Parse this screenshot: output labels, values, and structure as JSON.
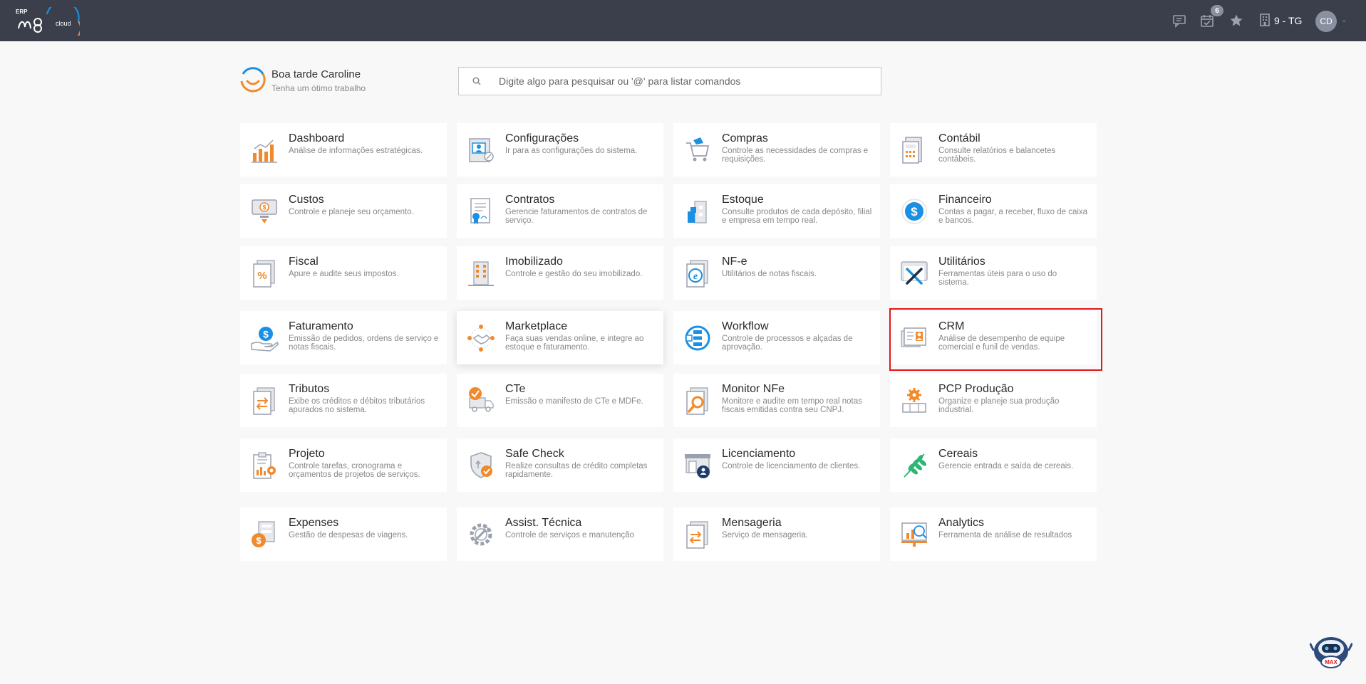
{
  "topbar": {
    "logo_erp": "ERP",
    "logo_cloud": "cloud",
    "badge_count": "6",
    "company": "9 - TG",
    "avatar": "CD",
    "icons": [
      "chat-icon",
      "calendar-check-icon",
      "star-icon",
      "building-icon",
      "chevron-down-icon"
    ]
  },
  "greeting": {
    "title": "Boa tarde Caroline",
    "subtitle": "Tenha um ótimo trabalho"
  },
  "search": {
    "placeholder": "Digite algo para pesquisar ou '@' para listar comandos"
  },
  "modules": [
    {
      "title": "Dashboard",
      "desc": "Análise de informações estratégicas.",
      "icon": "bar-chart-icon"
    },
    {
      "title": "Configurações",
      "desc": "Ir para as configurações do sistema.",
      "icon": "settings-profile-icon"
    },
    {
      "title": "Compras",
      "desc": "Controle as necessidades de compras e requisições.",
      "icon": "shopping-cart-icon"
    },
    {
      "title": "Contábil",
      "desc": "Consulte relatórios e balancetes contábeis.",
      "icon": "calculator-icon"
    },
    {
      "title": "Custos",
      "desc": "Controle e planeje seu orçamento.",
      "icon": "cost-monitor-icon"
    },
    {
      "title": "Contratos",
      "desc": "Gerencie faturamentos de contratos de serviço.",
      "icon": "contract-icon"
    },
    {
      "title": "Estoque",
      "desc": "Consulte produtos de cada depósito, filial e empresa em tempo real.",
      "icon": "warehouse-icon"
    },
    {
      "title": "Financeiro",
      "desc": "Contas a pagar, a receber, fluxo de caixa e bancos.",
      "icon": "dollar-circle-icon"
    },
    {
      "title": "Fiscal",
      "desc": "Apure e audite seus impostos.",
      "icon": "percent-document-icon"
    },
    {
      "title": "Imobilizado",
      "desc": "Controle e gestão do seu imobilizado.",
      "icon": "building-asset-icon"
    },
    {
      "title": "NF-e",
      "desc": "Utilitários de notas fiscais.",
      "icon": "nfe-document-icon"
    },
    {
      "title": "Utilitários",
      "desc": "Ferramentas úteis para o uso do sistema.",
      "icon": "tools-icon"
    },
    {
      "title": "Faturamento",
      "desc": "Emissão de pedidos, ordens de serviço e notas fiscais.",
      "icon": "billing-hand-icon"
    },
    {
      "title": "Marketplace",
      "desc": "Faça suas vendas online, e integre ao estoque e faturamento.",
      "icon": "handshake-network-icon"
    },
    {
      "title": "Workflow",
      "desc": "Controle de processos e alçadas de aprovação.",
      "icon": "workflow-icon"
    },
    {
      "title": "CRM",
      "desc": "Análise de desempenho de equipe comercial e funil de vendas.",
      "icon": "crm-cards-icon"
    },
    {
      "title": "Tributos",
      "desc": "Exibe os créditos e débitos tributários apurados no sistema.",
      "icon": "tax-transfer-icon"
    },
    {
      "title": "CTe",
      "desc": "Emissão e manifesto de CTe e MDFe.",
      "icon": "truck-check-icon"
    },
    {
      "title": "Monitor NFe",
      "desc": "Monitore e audite em tempo real notas fiscais emitidas contra seu CNPJ.",
      "icon": "magnifier-document-icon"
    },
    {
      "title": "PCP Produção",
      "desc": "Organize e planeje sua produção industrial.",
      "icon": "production-gear-icon"
    },
    {
      "title": "Projeto",
      "desc": "Controle tarefas, cronograma e orçamentos de projetos de serviços.",
      "icon": "project-clipboard-icon"
    },
    {
      "title": "Safe Check",
      "desc": "Realize consultas de crédito completas rapidamente.",
      "icon": "shield-check-icon"
    },
    {
      "title": "Licenciamento",
      "desc": "Controle de licenciamento de clientes.",
      "icon": "license-store-icon"
    },
    {
      "title": "Cereais",
      "desc": "Gerencie entrada e saída de cereais.",
      "icon": "leaf-icon"
    },
    {
      "title": "Expenses",
      "desc": "Gestão de despesas de viagens.",
      "icon": "expense-dollar-icon"
    },
    {
      "title": "Assist. Técnica",
      "desc": "Controle de serviços e manutenção",
      "icon": "wrench-gear-icon"
    },
    {
      "title": "Mensageria",
      "desc": "Serviço de mensageria.",
      "icon": "message-transfer-icon"
    },
    {
      "title": "Analytics",
      "desc": "Ferramenta de análise de resultados",
      "icon": "analytics-board-icon"
    }
  ],
  "bot": {
    "label": "MAX"
  },
  "colors": {
    "topbar": "#3a3f4b",
    "accent_orange": "#f08a2c",
    "accent_blue": "#1a8fe3",
    "highlight": "#e01818",
    "leaf_green": "#2bb673"
  }
}
